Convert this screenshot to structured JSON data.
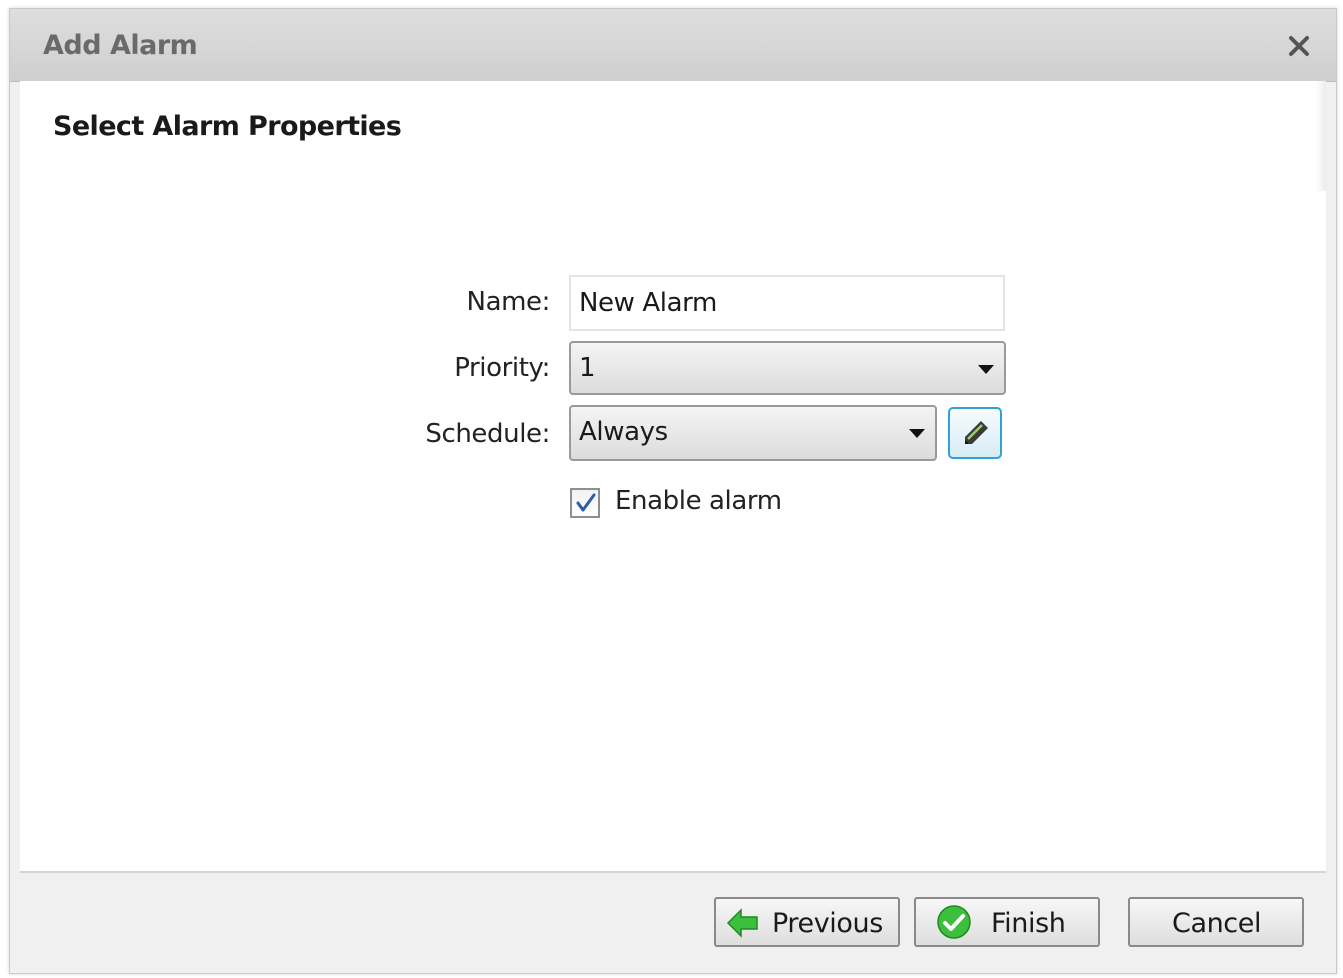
{
  "dialog": {
    "title": "Add Alarm",
    "close_icon": "close-icon"
  },
  "section": {
    "title": "Select Alarm Properties"
  },
  "form": {
    "name_label": "Name:",
    "name_value": "New Alarm",
    "priority_label": "Priority:",
    "priority_value": "1",
    "schedule_label": "Schedule:",
    "schedule_value": "Always",
    "schedule_edit_icon": "pencil-icon",
    "enable_label": "Enable alarm",
    "enable_checked": true
  },
  "footer": {
    "previous_label": "Previous",
    "previous_icon": "green-left-arrow-icon",
    "finish_label": "Finish",
    "finish_icon": "green-check-icon",
    "cancel_label": "Cancel"
  },
  "colors": {
    "edit_button_border": "#2ea3d6",
    "icon_green": "#3cbf3c"
  }
}
